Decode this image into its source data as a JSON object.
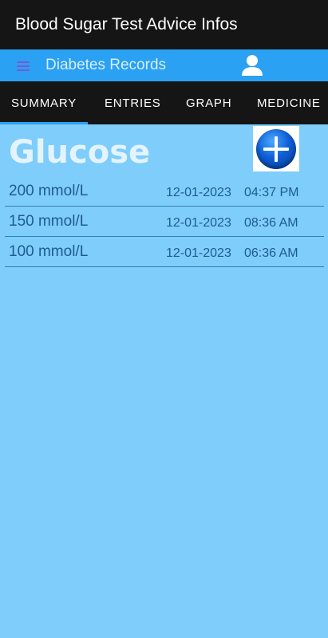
{
  "app": {
    "title": "Blood Sugar Test Advice Infos"
  },
  "toolbar": {
    "title": "Diabetes Records",
    "menu_icon": "hamburger-menu-icon",
    "user_icon": "user-account-icon"
  },
  "tabs": [
    {
      "label": "SUMMARY",
      "active": true
    },
    {
      "label": "ENTRIES",
      "active": false
    },
    {
      "label": "GRAPH",
      "active": false
    },
    {
      "label": "MEDICINE",
      "active": false
    }
  ],
  "summary": {
    "heading": "Glucose",
    "add_icon": "plus-circle-icon",
    "entries": [
      {
        "value": "200 mmol/L",
        "date": "12-01-2023",
        "time": "04:37 PM"
      },
      {
        "value": "150 mmol/L",
        "date": "12-01-2023",
        "time": "08:36 AM"
      },
      {
        "value": "100 mmol/L",
        "date": "12-01-2023",
        "time": "06:36 AM"
      }
    ]
  },
  "colors": {
    "background": "#7fcdfa",
    "toolbar": "#2aa1f2",
    "bars": "#151515",
    "text_dark_blue": "#1f5b8e"
  }
}
